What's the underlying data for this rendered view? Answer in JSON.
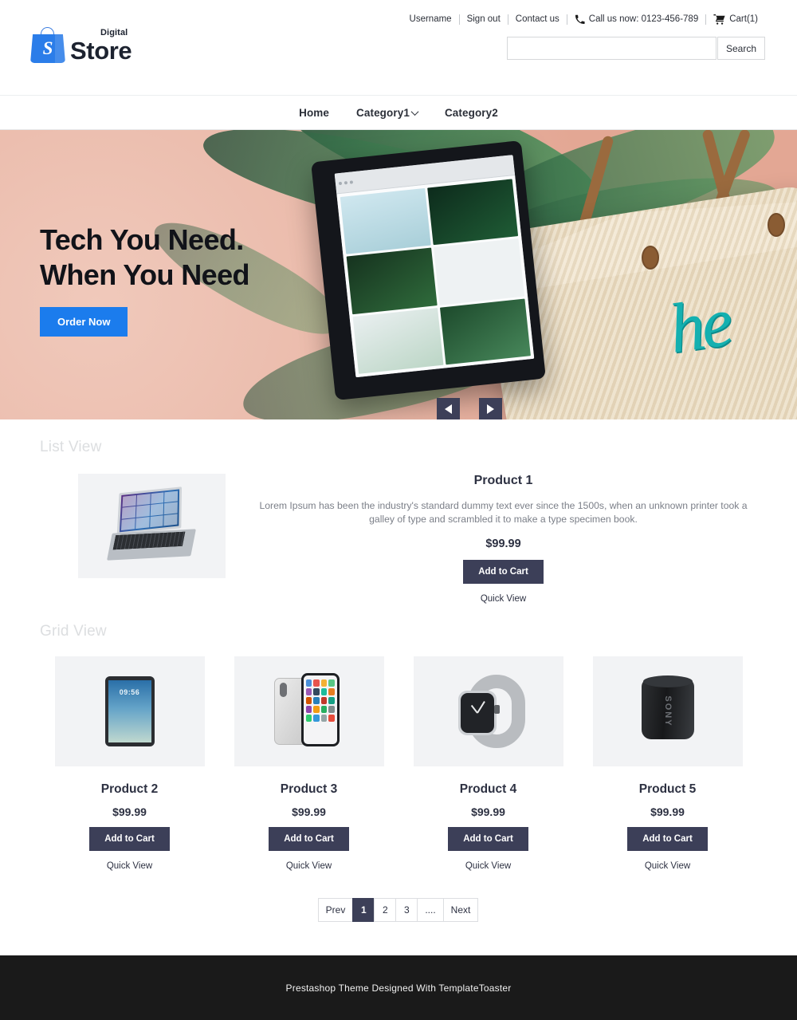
{
  "header": {
    "utility": {
      "username": "Username",
      "sign_out": "Sign out",
      "contact_us": "Contact us",
      "phone_icon": "phone-icon",
      "call_text": "Call us now: 0123-456-789",
      "cart_icon": "cart-icon",
      "cart_label": "Cart(1)"
    },
    "logo": {
      "mark_letter": "S",
      "small_text": "Digital",
      "main_text": "Store"
    },
    "search": {
      "value": "",
      "placeholder": "",
      "button_label": "Search"
    }
  },
  "nav": {
    "items": [
      {
        "label": "Home",
        "has_dropdown": false
      },
      {
        "label": "Category1",
        "has_dropdown": true
      },
      {
        "label": "Category2",
        "has_dropdown": false
      }
    ]
  },
  "hero": {
    "title_line1": "Tech You Need.",
    "title_line2": "When You Need",
    "cta_label": "Order Now",
    "prev_icon": "arrow-left-icon",
    "next_icon": "arrow-right-icon",
    "accent_color": "#1b7ced"
  },
  "sections": {
    "list_view_title": "List View",
    "grid_view_title": "Grid View"
  },
  "list_products": [
    {
      "name": "Product 1",
      "description": "Lorem Ipsum has been the industry's standard dummy text ever since the 1500s, when an unknown printer took a galley of type and scrambled it to make a type specimen book.",
      "price": "$99.99",
      "add_to_cart": "Add to Cart",
      "quick_view": "Quick View",
      "image": "laptop-2in1"
    }
  ],
  "grid_products": [
    {
      "name": "Product 2",
      "price": "$99.99",
      "add_to_cart": "Add to Cart",
      "quick_view": "Quick View",
      "image": "tablet",
      "screen_time": "09:56"
    },
    {
      "name": "Product 3",
      "price": "$99.99",
      "add_to_cart": "Add to Cart",
      "quick_view": "Quick View",
      "image": "smartphone"
    },
    {
      "name": "Product 4",
      "price": "$99.99",
      "add_to_cart": "Add to Cart",
      "quick_view": "Quick View",
      "image": "smartwatch"
    },
    {
      "name": "Product 5",
      "price": "$99.99",
      "add_to_cart": "Add to Cart",
      "quick_view": "Quick View",
      "image": "bluetooth-speaker",
      "brand": "SONY"
    }
  ],
  "pagination": {
    "prev": "Prev",
    "pages": [
      "1",
      "2",
      "3",
      "...."
    ],
    "next": "Next",
    "active_index": 0,
    "active_color": "#3c3f58"
  },
  "footer": {
    "text": "Prestashop Theme Designed With TemplateToaster"
  },
  "theme": {
    "dark_navy": "#3c3f58",
    "blue": "#1b7ced",
    "footer_bg": "#1a1a1a",
    "muted_title": "#dcdee0"
  }
}
